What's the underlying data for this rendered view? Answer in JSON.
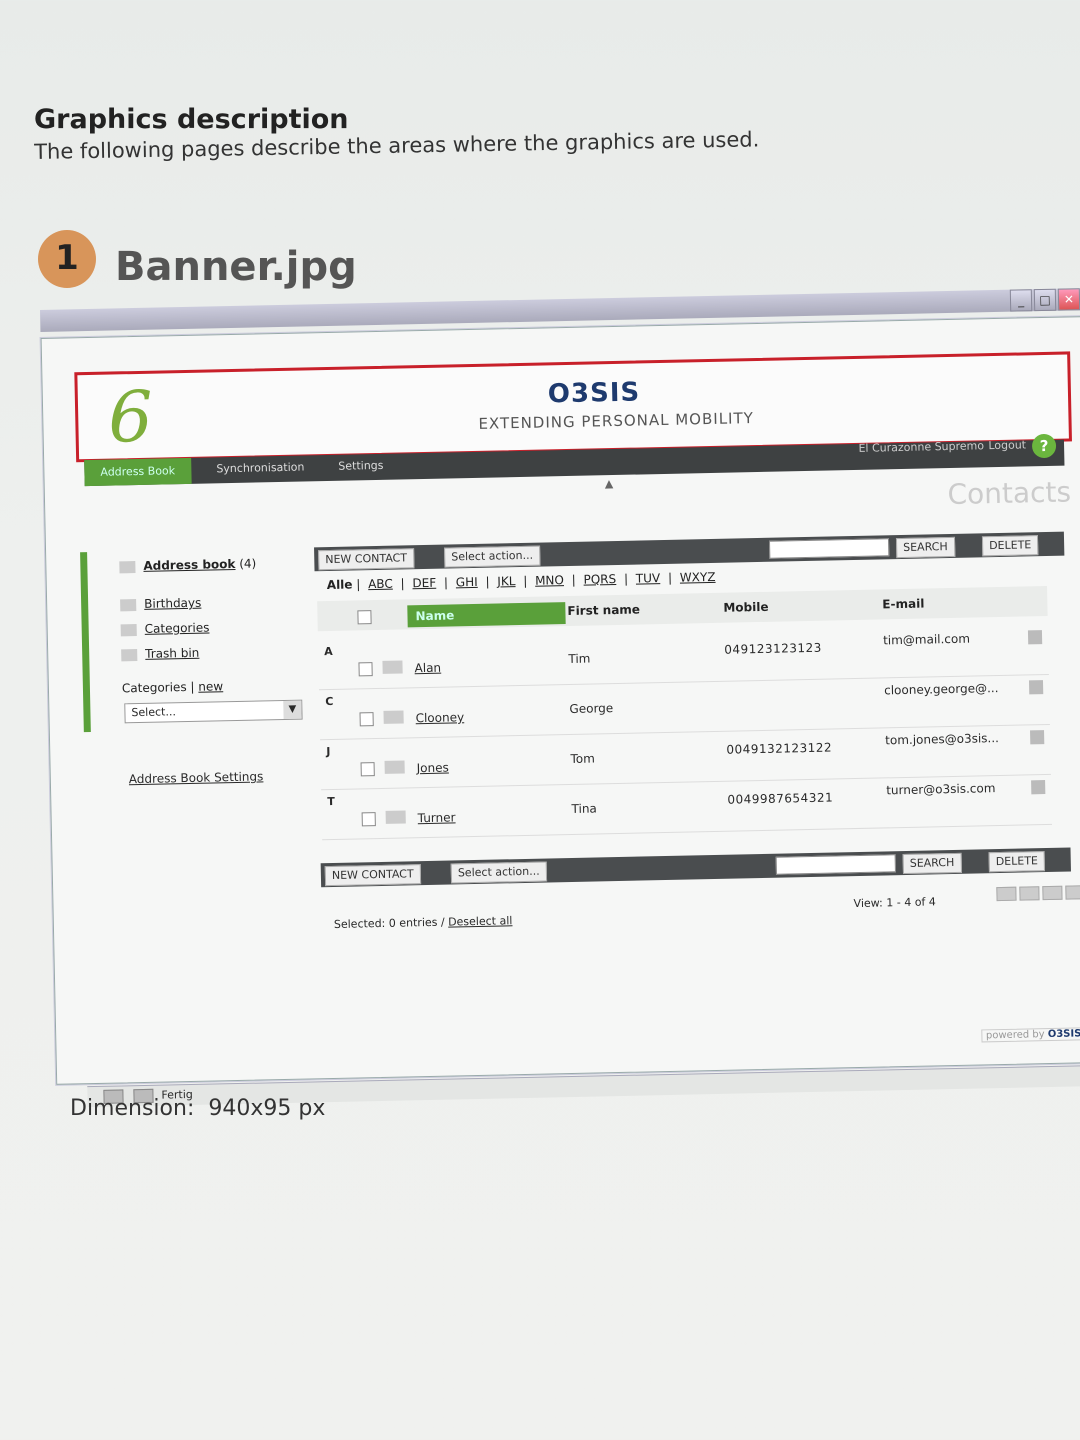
{
  "doc": {
    "heading": "Graphics description",
    "intro": "The following pages describe the areas where the graphics are used.",
    "step_number": "1",
    "step_title": "Banner.jpg",
    "dimension_label": "Dimension:",
    "dimension_value": "940x95 px"
  },
  "app": {
    "window_buttons": [
      "_",
      "□",
      "✕"
    ],
    "banner": {
      "version_mark": "6",
      "logo": "O3SIS",
      "tagline": "EXTENDING PERSONAL MOBILITY"
    },
    "nav": {
      "tabs": [
        "Address Book",
        "Synchronisation",
        "Settings"
      ],
      "user": "El Curazonne Supremo",
      "separator": "|",
      "logout": "Logout",
      "help": "?"
    },
    "page_title": "Contacts",
    "sidebar": {
      "address_book": "Address book",
      "address_book_count": "(4)",
      "birthdays": "Birthdays",
      "categories": "Categories",
      "trash": "Trash bin",
      "categories_label": "Categories",
      "separator": "|",
      "new_link": "new",
      "select_placeholder": "Select...",
      "settings_link": "Address Book Settings"
    },
    "toolbar": {
      "new_contact": "NEW CONTACT",
      "select_action": "Select action...",
      "search": "SEARCH",
      "delete": "DELETE"
    },
    "alphabet": [
      "Alle",
      "ABC",
      "DEF",
      "GHI",
      "JKL",
      "MNO",
      "PQRS",
      "TUV",
      "WXYZ"
    ],
    "columns": {
      "name": "Name",
      "first_name": "First name",
      "mobile": "Mobile",
      "email": "E-mail"
    },
    "rows": [
      {
        "letter": "A",
        "name": "Alan",
        "first": "Tim",
        "mobile": "049123123123",
        "email": "tim@mail.com"
      },
      {
        "letter": "C",
        "name": "Clooney",
        "first": "George",
        "mobile": "",
        "email": "clooney.george@..."
      },
      {
        "letter": "J",
        "name": "Jones",
        "first": "Tom",
        "mobile": "0049132123122",
        "email": "tom.jones@o3sis..."
      },
      {
        "letter": "T",
        "name": "Turner",
        "first": "Tina",
        "mobile": "0049987654321",
        "email": "turner@o3sis.com"
      }
    ],
    "footer": {
      "selected": "Selected: 0 entries /",
      "deselect": "Deselect all",
      "view": "View: 1 - 4 of 4",
      "powered_prefix": "powered by",
      "powered_brand": "O3SIS"
    },
    "statusbar": {
      "text": "Fertig"
    }
  }
}
